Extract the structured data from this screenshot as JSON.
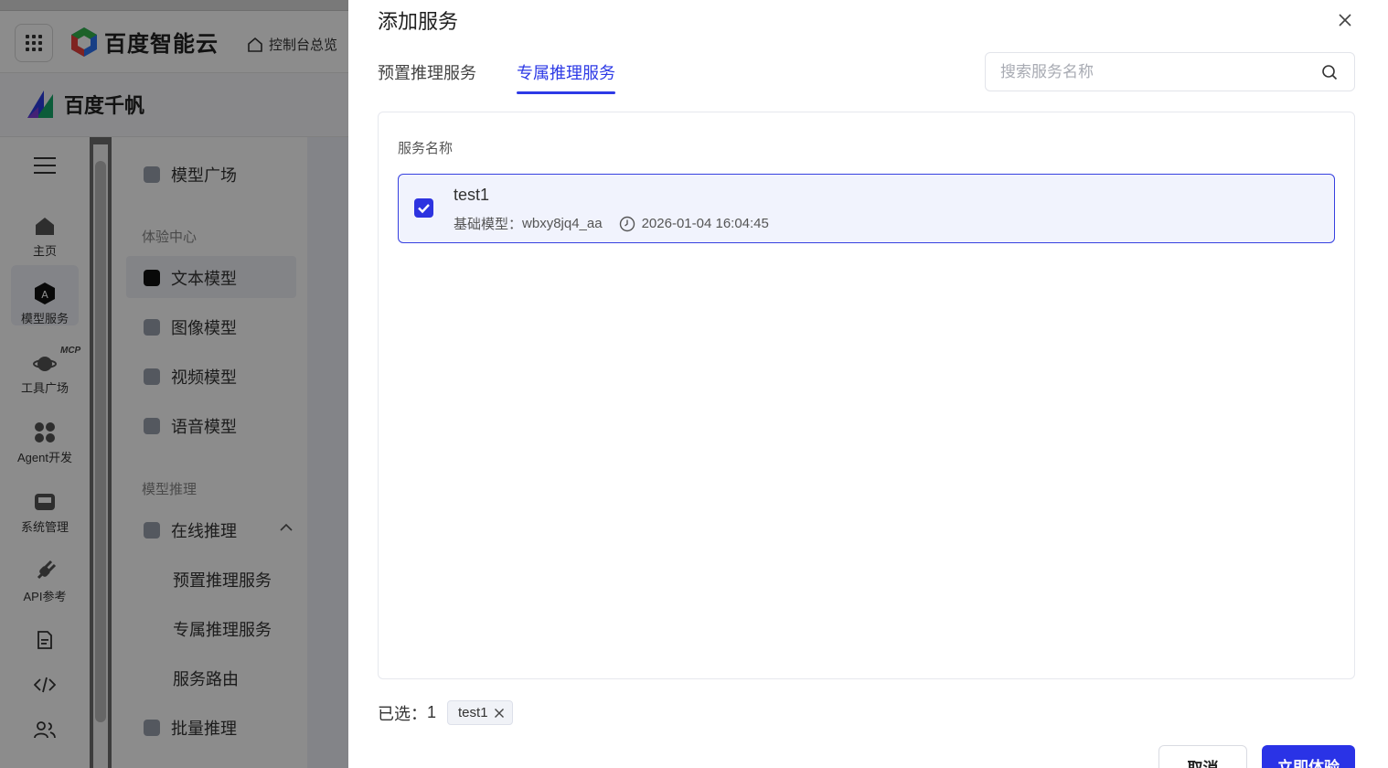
{
  "background": {
    "console": {
      "brand": "百度智能云",
      "console_link": "控制台总览"
    },
    "product": "百度千帆",
    "rail": [
      {
        "label": "主页"
      },
      {
        "label": "模型服务"
      },
      {
        "label": "工具广场",
        "badge": "MCP"
      },
      {
        "label": "Agent开发"
      },
      {
        "label": "系统管理"
      },
      {
        "label": "API参考"
      }
    ],
    "nav": {
      "model_square": "模型广场",
      "group_experience": "体验中心",
      "text_model": "文本模型",
      "image_model": "图像模型",
      "video_model": "视频模型",
      "voice_model": "语音模型",
      "group_inference": "模型推理",
      "online_inference": "在线推理",
      "preset_service": "预置推理服务",
      "dedicated_service": "专属推理服务",
      "service_route": "服务路由",
      "batch_inference": "批量推理"
    }
  },
  "drawer": {
    "title": "添加服务",
    "tabs": [
      {
        "label": "预置推理服务",
        "active": false
      },
      {
        "label": "专属推理服务",
        "active": true
      }
    ],
    "search": {
      "placeholder": "搜索服务名称",
      "value": ""
    },
    "column_header": "服务名称",
    "services": [
      {
        "name": "test1",
        "checked": true,
        "base_model_label": "基础模型：",
        "base_model": "wbxy8jq4_aa",
        "time": "2026-01-04 16:04:45"
      }
    ],
    "selected": {
      "label": "已选：",
      "count": "1",
      "tags": [
        "test1"
      ]
    },
    "buttons": {
      "cancel": "取消",
      "confirm": "立即体验"
    }
  },
  "colors": {
    "accent": "#2d3ae6",
    "selected_row_bg": "#f1f3fd",
    "overlay": "rgba(0,0,0,0.45)"
  }
}
